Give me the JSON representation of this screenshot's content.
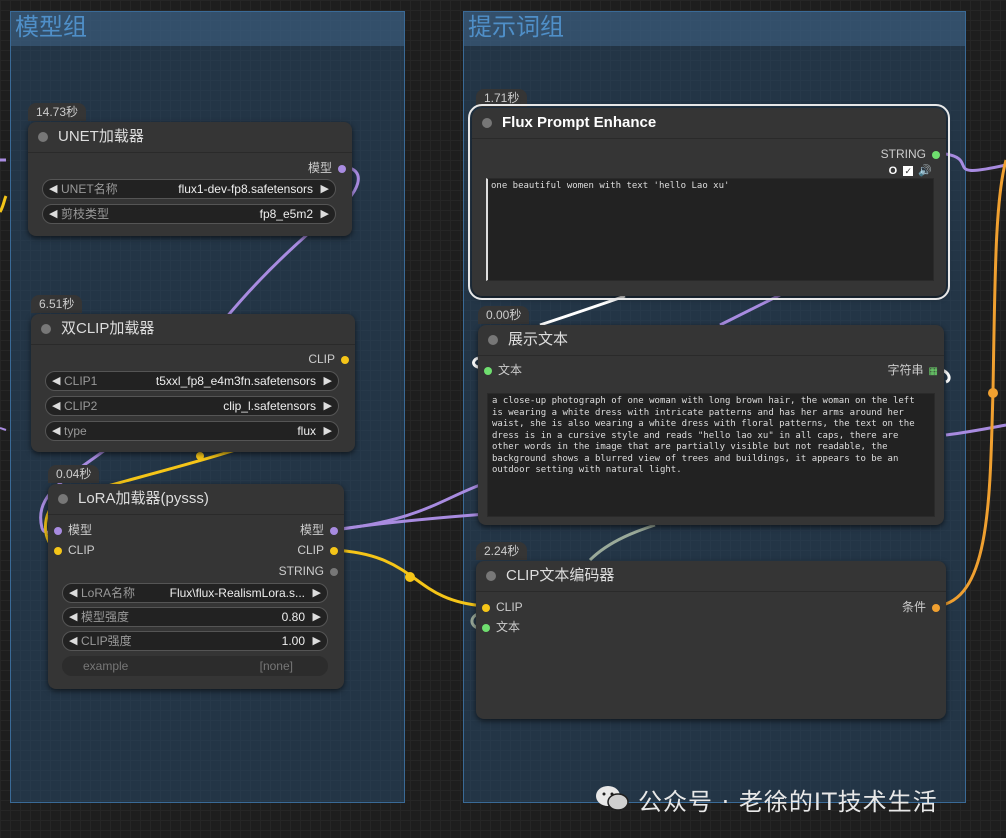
{
  "groups": {
    "model": {
      "title": "模型组"
    },
    "prompt": {
      "title": "提示词组"
    }
  },
  "colors": {
    "model_link": "#a88be0",
    "clip_link": "#f5c518",
    "string_link": "#9aaa9a",
    "cond_link": "#f0a030",
    "group_bg": "#284868",
    "node_bg": "#353535",
    "canvas_bg": "#1e1e1e"
  },
  "nodes": {
    "unet": {
      "time": "14.73秒",
      "title": "UNET加载器",
      "out_model": "模型",
      "w1_label": "UNET名称",
      "w1_value": "flux1-dev-fp8.safetensors",
      "w2_label": "剪枝类型",
      "w2_value": "fp8_e5m2"
    },
    "dualclip": {
      "time": "6.51秒",
      "title": "双CLIP加载器",
      "out_clip": "CLIP",
      "w1_label": "CLIP1",
      "w1_value": "t5xxl_fp8_e4m3fn.safetensors",
      "w2_label": "CLIP2",
      "w2_value": "clip_l.safetensors",
      "w3_label": "type",
      "w3_value": "flux"
    },
    "lora": {
      "time": "0.04秒",
      "title": "LoRA加载器(pysss)",
      "in_model": "模型",
      "in_clip": "CLIP",
      "out_model": "模型",
      "out_clip": "CLIP",
      "out_string": "STRING",
      "w1_label": "LoRA名称",
      "w1_value": "Flux\\flux-RealismLora.s...",
      "w2_label": "模型强度",
      "w2_value": "0.80",
      "w3_label": "CLIP强度",
      "w3_value": "1.00",
      "w4_label": "example",
      "w4_value": "[none]"
    },
    "flux": {
      "time": "1.71秒",
      "title": "Flux Prompt Enhance",
      "out_string": "STRING",
      "text": "one beautiful women with text 'hello Lao xu'",
      "toolbar_counter": "O"
    },
    "show": {
      "time": "0.00秒",
      "title": "展示文本",
      "in_text": "文本",
      "out_string": "字符串",
      "text": "a close-up photograph of one woman with long brown hair, the woman on the left is wearing a white dress with intricate patterns and has her arms around her waist, she is also wearing a white dress with floral patterns, the text on the dress is in a cursive style and reads \"hello lao xu\" in all caps, there are other words in the image that are partially visible but not readable, the background shows a blurred view of trees and buildings, it appears to be an outdoor setting with natural light."
    },
    "clipenc": {
      "time": "2.24秒",
      "title": "CLIP文本编码器",
      "in_clip": "CLIP",
      "in_text": "文本",
      "out_cond": "条件"
    }
  },
  "watermark": "公众号 · 老徐的IT技术生活"
}
